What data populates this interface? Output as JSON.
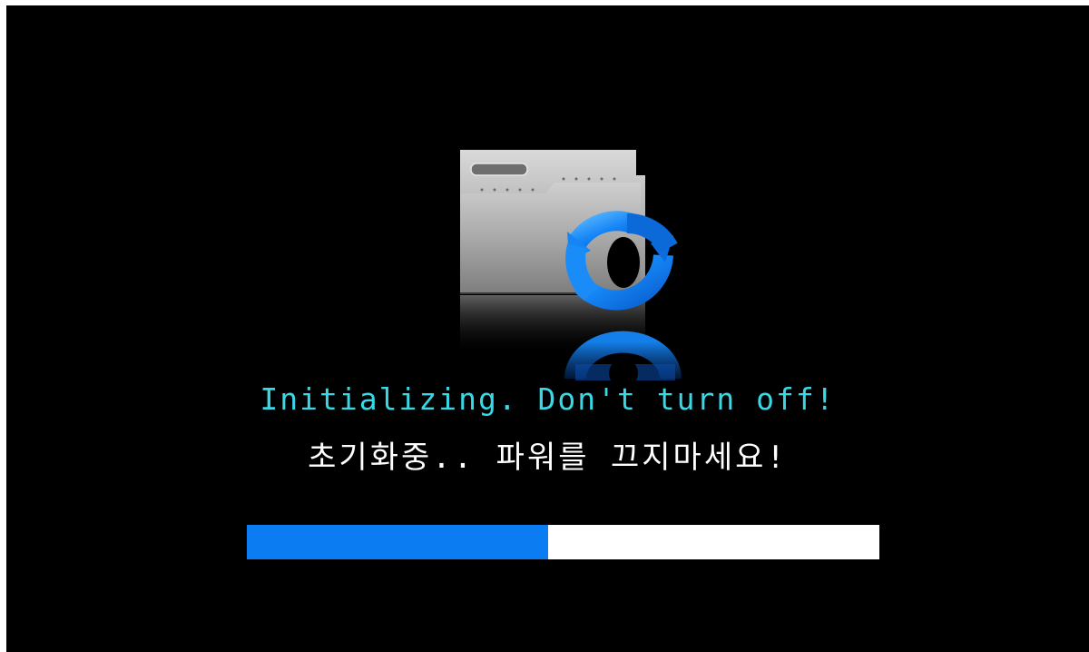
{
  "status": {
    "message_en": "Initializing. Don't turn off!",
    "message_ko": "초기화중.. 파워를 끄지마세요!"
  },
  "icon": {
    "name": "folder-sync-icon",
    "arrow_color": "#0b7cf2"
  },
  "progress": {
    "fraction": 0.476,
    "fill_color": "#0b7cf2",
    "track_color": "#ffffff"
  },
  "colors": {
    "background": "#000000",
    "message_en": "#38d8e6",
    "message_ko": "#ffffff"
  }
}
